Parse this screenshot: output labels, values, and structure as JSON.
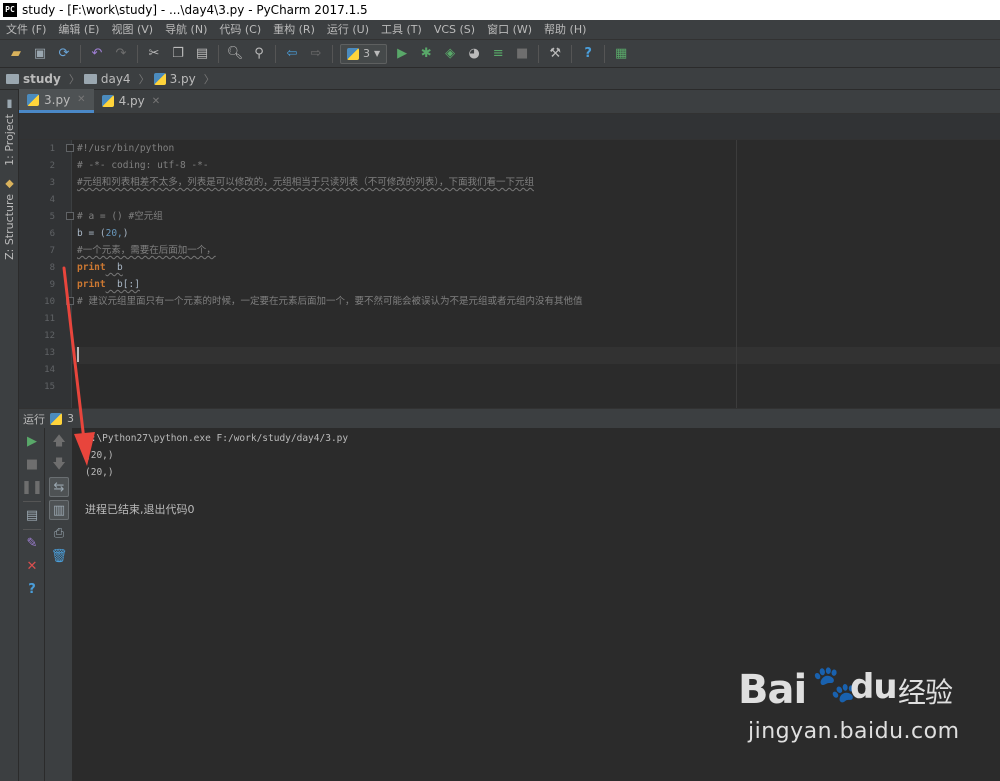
{
  "window": {
    "title": "study - [F:\\work\\study] - ...\\day4\\3.py - PyCharm 2017.1.5",
    "app_icon_text": "PC"
  },
  "menubar": {
    "items": [
      "文件 (F)",
      "编辑 (E)",
      "视图 (V)",
      "导航 (N)",
      "代码 (C)",
      "重构 (R)",
      "运行 (U)",
      "工具 (T)",
      "VCS (S)",
      "窗口 (W)",
      "帮助 (H)"
    ]
  },
  "toolbar": {
    "run_config_label": "3"
  },
  "breadcrumb": {
    "items": [
      "study",
      "day4",
      "3.py"
    ]
  },
  "left_strip": {
    "project_label": "1: Project",
    "structure_label": "Z: Structure"
  },
  "editor": {
    "tabs": [
      {
        "label": "3.py",
        "active": true
      },
      {
        "label": "4.py",
        "active": false
      }
    ],
    "line_numbers": [
      "1",
      "2",
      "3",
      "4",
      "5",
      "6",
      "7",
      "8",
      "9",
      "10",
      "11",
      "12",
      "13",
      "14",
      "15"
    ],
    "lines": {
      "l1": "#!/usr/bin/python",
      "l2": "# -*- coding: utf-8 -*-",
      "l3": "#元组和列表相差不太多，列表是可以修改的，元组相当于只读列表（不可修改的列表），下面我们看一下元组",
      "l5a": "# a = () ",
      "l5b": "#空元组",
      "l6a": "b = (",
      "l6b": "20,",
      "l6c": ")",
      "l7": "#一个元素，需要在后面加一个，",
      "l8a": "print",
      "l8b": "  b",
      "l9a": "print",
      "l9b": "  b[:]",
      "l10": "# 建议元组里面只有一个元素的时候，一定要在元素后面加一个，要不然可能会被误认为不是元组或者元组内没有其他值"
    }
  },
  "run_panel": {
    "label": "运行",
    "config_name": "3",
    "console": {
      "command": "C:\\Python27\\python.exe F:/work/study/day4/3.py",
      "out1": "(20,)",
      "out2": "(20,)",
      "exit_message": "进程已结束,退出代码0"
    }
  },
  "watermark": {
    "logo_text": "Bai du 经验",
    "url": "jingyan.baidu.com"
  },
  "colors": {
    "annotation_arrow": "#e8453c",
    "keyword": "#cc7832",
    "number": "#6897bb",
    "comment": "#808080"
  }
}
